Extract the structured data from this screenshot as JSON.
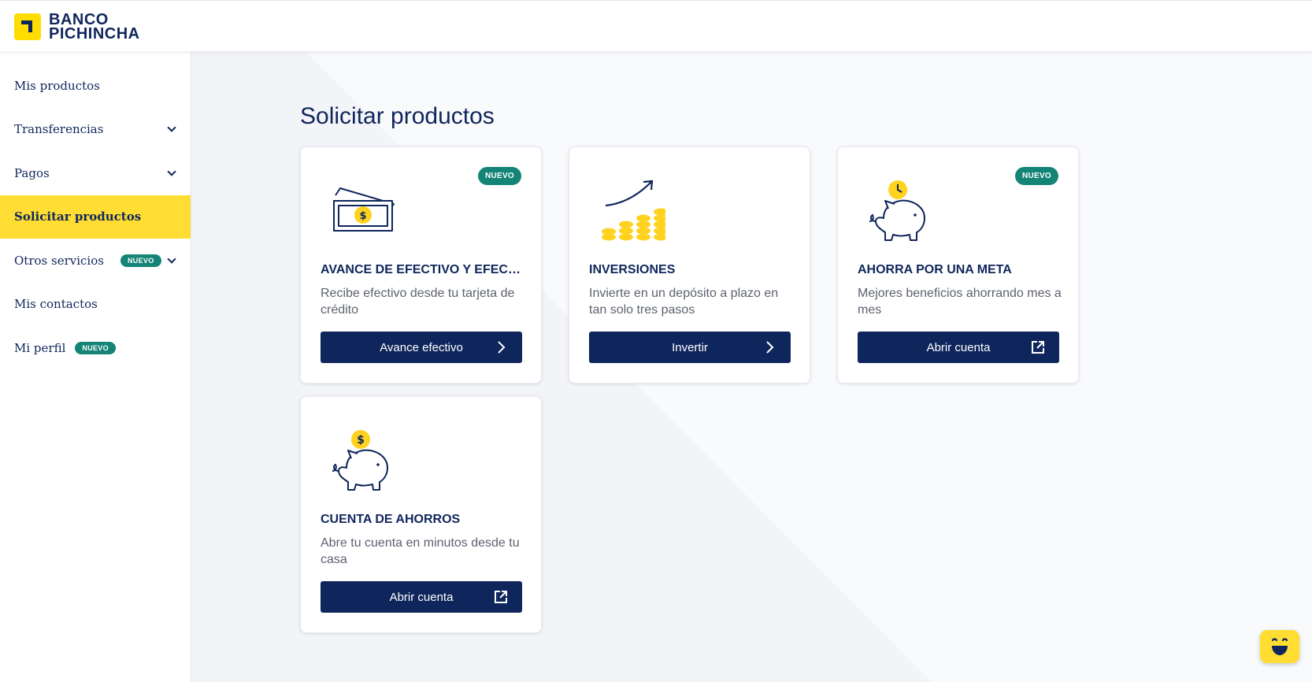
{
  "brand": {
    "name_line1": "BANCO",
    "name_line2": "PICHINCHA",
    "accent": "#ffdd00",
    "navy": "#0f265c",
    "teal": "#138476"
  },
  "sidebar": {
    "items": [
      {
        "label": "Mis productos"
      },
      {
        "label": "Transferencias",
        "has_chevron": true
      },
      {
        "label": "Pagos",
        "has_chevron": true
      },
      {
        "label": "Solicitar productos",
        "active": true
      },
      {
        "label": "Otros servicios",
        "badge": "NUEVO",
        "has_chevron": true
      },
      {
        "label": "Mis contactos"
      },
      {
        "label": "Mi perfil",
        "badge": "NUEVO"
      }
    ]
  },
  "main": {
    "title": "Solicitar productos",
    "cards": [
      {
        "badge": "NUEVO",
        "icon": "cash-bills-icon",
        "title": "AVANCE DE EFECTIVO Y EFECTIVO",
        "description": "Recibe efectivo desde tu tarjeta de crédito",
        "button_label": "Avance efectivo",
        "button_icon": "chevron-right-icon"
      },
      {
        "icon": "coins-growth-icon",
        "title": "INVERSIONES",
        "description": "Invierte en un depósito a plazo en tan solo tres pasos",
        "button_label": "Invertir",
        "button_icon": "chevron-right-icon"
      },
      {
        "badge": "NUEVO",
        "icon": "piggy-bank-clock-icon",
        "title": "AHORRA POR UNA META",
        "description": "Mejores beneficios ahorrando mes a mes",
        "button_label": "Abrir cuenta",
        "button_icon": "external-link-icon"
      },
      {
        "icon": "piggy-bank-coin-icon",
        "title": "CUENTA DE AHORROS",
        "description": "Abre tu cuenta en minutos desde tu casa",
        "button_label": "Abrir cuenta",
        "button_icon": "external-link-icon"
      }
    ]
  },
  "chatbot": {
    "icon": "chatbot-face-icon"
  }
}
